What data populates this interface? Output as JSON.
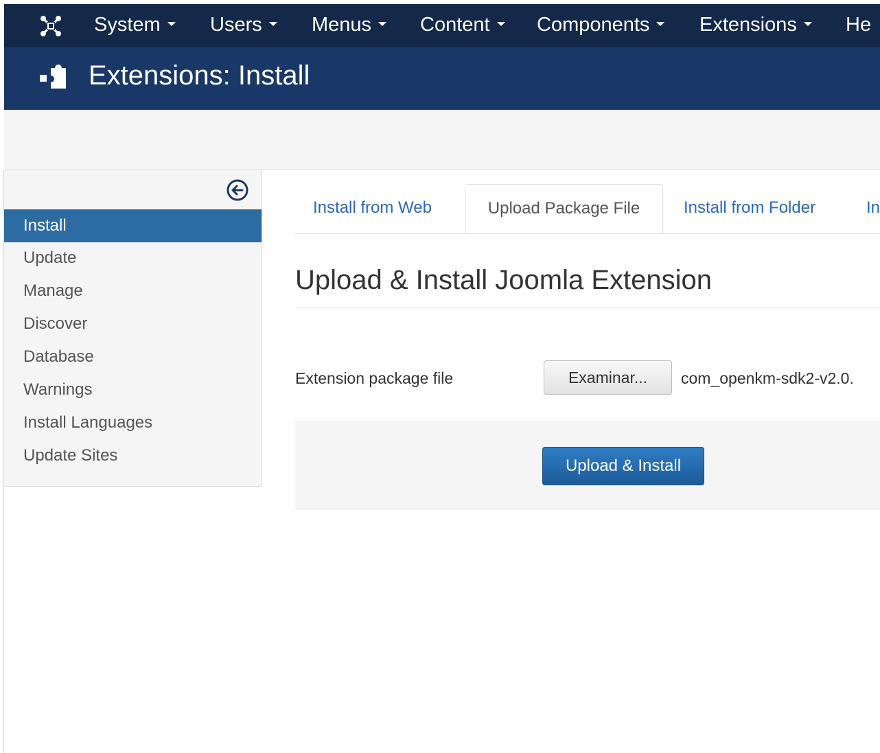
{
  "topbar": {
    "brand_icon": "joomla-logo-icon",
    "menu": [
      {
        "label": "System"
      },
      {
        "label": "Users"
      },
      {
        "label": "Menus"
      },
      {
        "label": "Content"
      },
      {
        "label": "Components"
      },
      {
        "label": "Extensions"
      },
      {
        "label": "He"
      }
    ]
  },
  "header": {
    "icon": "puzzle-piece-icon",
    "title": "Extensions: Install"
  },
  "sidebar": {
    "collapse_icon": "arrow-circle-left-icon",
    "items": [
      {
        "label": "Install",
        "active": true
      },
      {
        "label": "Update"
      },
      {
        "label": "Manage"
      },
      {
        "label": "Discover"
      },
      {
        "label": "Database"
      },
      {
        "label": "Warnings"
      },
      {
        "label": "Install Languages"
      },
      {
        "label": "Update Sites"
      }
    ]
  },
  "tabs": [
    {
      "label": "Install from Web"
    },
    {
      "label": "Upload Package File",
      "active": true
    },
    {
      "label": "Install from Folder"
    },
    {
      "label": "In"
    }
  ],
  "main": {
    "title": "Upload & Install Joomla Extension",
    "field_label": "Extension package file",
    "browse_label": "Examinar...",
    "file_name": "com_openkm-sdk2-v2.0.",
    "submit_label": "Upload & Install"
  },
  "colors": {
    "topbar": "#142849",
    "subhead": "#1a3867",
    "active_item": "#2d6ca2",
    "link": "#2a69b8",
    "primary_button": "#2f7dc5"
  }
}
